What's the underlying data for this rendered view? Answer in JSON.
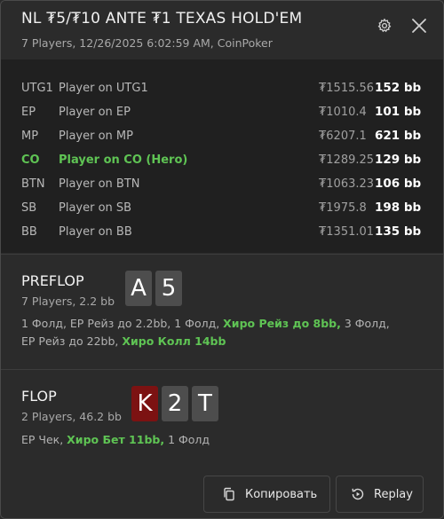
{
  "header": {
    "title": "NL ₮5/₮10 ANTE ₮1 TEXAS HOLD'EM",
    "subtitle": "7 Players, 12/26/2025 6:02:59 AM, CoinPoker"
  },
  "players": [
    {
      "pos": "UTG1",
      "name": "Player on UTG1",
      "amount": "₮1515.56",
      "bb": "152 bb",
      "hero": false
    },
    {
      "pos": "EP",
      "name": "Player on EP",
      "amount": "₮1010.4",
      "bb": "101 bb",
      "hero": false
    },
    {
      "pos": "MP",
      "name": "Player on MP",
      "amount": "₮6207.1",
      "bb": "621 bb",
      "hero": false
    },
    {
      "pos": "CO",
      "name": "Player on CO (Hero)",
      "amount": "₮1289.25",
      "bb": "129 bb",
      "hero": true
    },
    {
      "pos": "BTN",
      "name": "Player on BTN",
      "amount": "₮1063.23",
      "bb": "106 bb",
      "hero": false
    },
    {
      "pos": "SB",
      "name": "Player on SB",
      "amount": "₮1975.8",
      "bb": "198 bb",
      "hero": false
    },
    {
      "pos": "BB",
      "name": "Player on BB",
      "amount": "₮1351.01",
      "bb": "135 bb",
      "hero": false
    }
  ],
  "preflop": {
    "title": "PREFLOP",
    "sub": "7 Players, 2.2 bb",
    "cards": [
      {
        "rank": "A",
        "color": "#4d4d4d"
      },
      {
        "rank": "5",
        "color": "#4d4d4d"
      }
    ],
    "actions": [
      {
        "text": "1 Фолд, EP Рейз до 2.2bb, 1 Фолд, ",
        "hero": false
      },
      {
        "text": "Хиро Рейз до 8bb,",
        "hero": true
      },
      {
        "text": " 3 Фолд, EP Рейз до 22bb, ",
        "hero": false
      },
      {
        "text": "Хиро Колл 14bb",
        "hero": true
      }
    ]
  },
  "flop": {
    "title": "FLOP",
    "sub": "2 Players, 46.2 bb",
    "cards": [
      {
        "rank": "K",
        "color": "#7c1212"
      },
      {
        "rank": "2",
        "color": "#4d4d4d"
      },
      {
        "rank": "T",
        "color": "#4d4d4d"
      }
    ],
    "actions": [
      {
        "text": "EP Чек, ",
        "hero": false
      },
      {
        "text": "Хиро Бет 11bb,",
        "hero": true
      },
      {
        "text": " 1 Фолд",
        "hero": false
      }
    ]
  },
  "footer": {
    "copy_label": "Копировать",
    "copy_icon": "copy-icon",
    "replay_label": "Replay",
    "replay_icon": "replay-icon"
  },
  "icons": {
    "settings": "gear-icon",
    "close": "close-icon"
  },
  "colors": {
    "hero_green": "#5fc454",
    "red_card": "#7c1212",
    "gray_card": "#4d4d4d"
  }
}
